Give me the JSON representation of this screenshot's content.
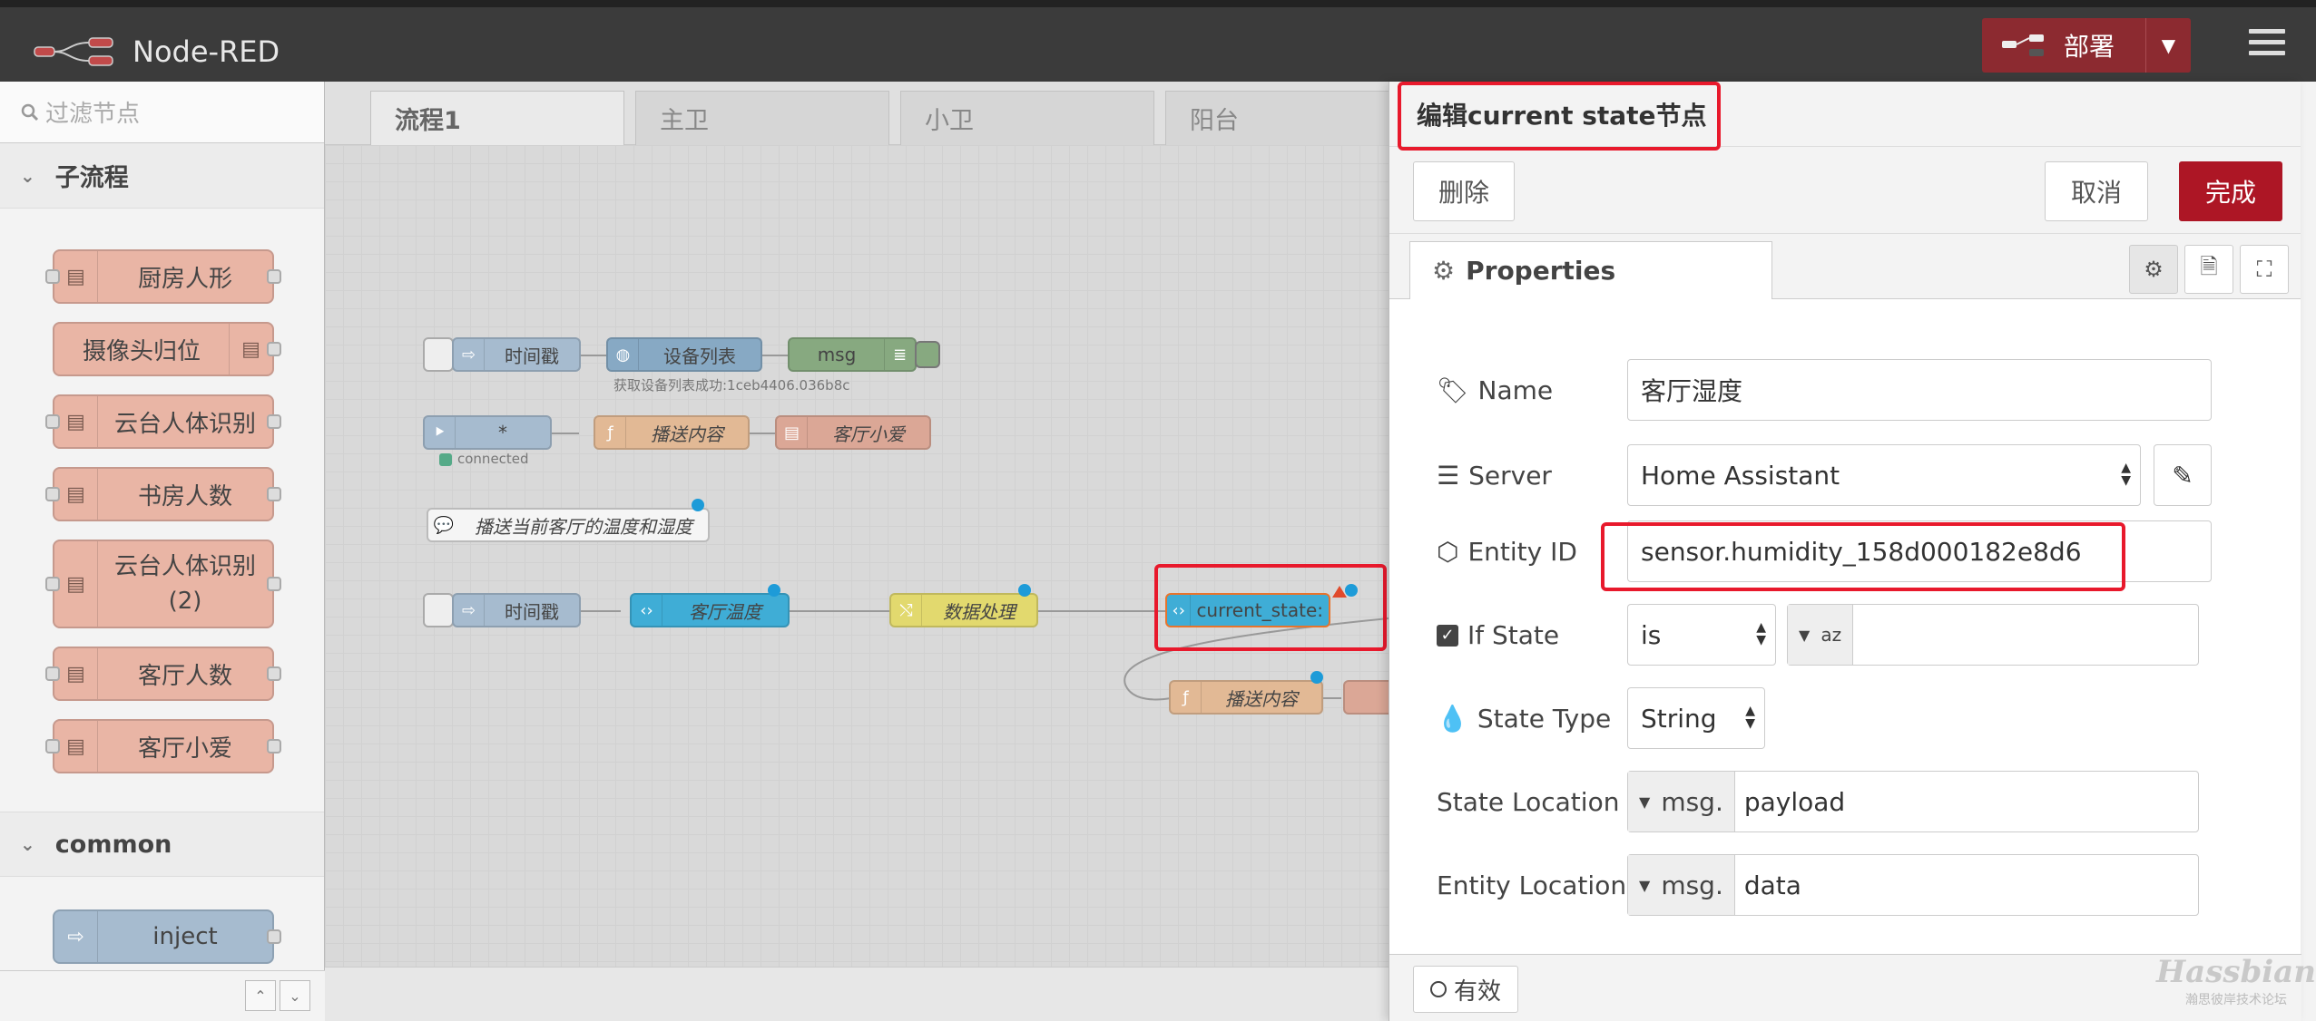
{
  "header": {
    "app_title": "Node-RED",
    "deploy_label": "部署",
    "deploy_caret": "▼",
    "menu_icon": "hamburger-icon"
  },
  "palette": {
    "search_placeholder": "过滤节点",
    "categories": [
      {
        "label": "子流程",
        "nodes": [
          "厨房人形",
          "摄像头归位",
          "云台人体识别",
          "书房人数",
          "云台人体识别\n(2)",
          "客厅人数",
          "客厅小爱"
        ]
      },
      {
        "label": "common",
        "nodes": [
          "inject"
        ]
      }
    ],
    "footer_up": "⌃",
    "footer_down": "⌄"
  },
  "workspace": {
    "tabs": [
      "流程1",
      "主卫",
      "小卫",
      "阳台"
    ],
    "active_tab": "流程1",
    "nodes": {
      "timestamp1": "时间戳",
      "device_list": "设备列表",
      "device_list_status": "获取设备列表成功:1ceb4406.036b8c",
      "msg": "msg",
      "star": "*",
      "connected": "connected",
      "broadcast1": "播送内容",
      "xiaoai1": "客厅小爱",
      "comment": "播送当前客厅的温度和湿度",
      "timestamp2": "时间戳",
      "living_temp": "客厅温度",
      "data_proc": "数据处理",
      "current_state": "current_state:",
      "broadcast2": "播送内容"
    }
  },
  "editor": {
    "title": "编辑current state节点",
    "delete_label": "删除",
    "cancel_label": "取消",
    "done_label": "完成",
    "tab_properties": "Properties",
    "fields": {
      "name_label": "Name",
      "name_value": "客厅湿度",
      "server_label": "Server",
      "server_value": "Home Assistant",
      "entity_label": "Entity ID",
      "entity_value": "sensor.humidity_158d000182e8d6",
      "ifstate_label": "If State",
      "ifstate_op": "is",
      "ifstate_type_icon": "az",
      "statetype_label": "State Type",
      "statetype_value": "String",
      "stateloc_label": "State Location",
      "stateloc_prefix": "msg.",
      "stateloc_value": "payload",
      "entityloc_label": "Entity Location",
      "entityloc_prefix": "msg.",
      "entityloc_value": "data"
    },
    "enabled_label": "有效"
  },
  "watermark": {
    "brand": "Hassbian",
    "sub": "瀚思彼岸技术论坛"
  },
  "colors": {
    "accent_red": "#ad1625",
    "highlight_red": "#e8192c",
    "header_bg": "#3b3b3b"
  }
}
